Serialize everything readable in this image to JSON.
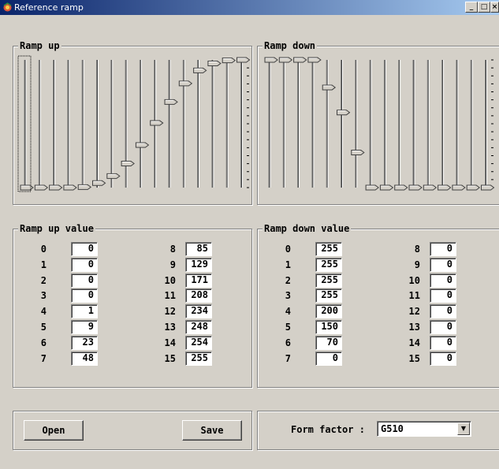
{
  "window": {
    "title": "Reference ramp",
    "minimize_label": "_",
    "maximize_label": "□",
    "close_label": "×"
  },
  "ramp_up": {
    "title": "Ramp up",
    "values": [
      0,
      0,
      0,
      0,
      1,
      9,
      23,
      48,
      85,
      129,
      171,
      208,
      234,
      248,
      254,
      255
    ]
  },
  "ramp_down": {
    "title": "Ramp down",
    "values": [
      255,
      255,
      255,
      255,
      200,
      150,
      70,
      0,
      0,
      0,
      0,
      0,
      0,
      0,
      0,
      0
    ]
  },
  "ramp_up_value": {
    "title": "Ramp up value",
    "left": [
      {
        "index": "0",
        "value": "0"
      },
      {
        "index": "1",
        "value": "0"
      },
      {
        "index": "2",
        "value": "0"
      },
      {
        "index": "3",
        "value": "0"
      },
      {
        "index": "4",
        "value": "1"
      },
      {
        "index": "5",
        "value": "9"
      },
      {
        "index": "6",
        "value": "23"
      },
      {
        "index": "7",
        "value": "48"
      }
    ],
    "right": [
      {
        "index": "8",
        "value": "85"
      },
      {
        "index": "9",
        "value": "129"
      },
      {
        "index": "10",
        "value": "171"
      },
      {
        "index": "11",
        "value": "208"
      },
      {
        "index": "12",
        "value": "234"
      },
      {
        "index": "13",
        "value": "248"
      },
      {
        "index": "14",
        "value": "254"
      },
      {
        "index": "15",
        "value": "255"
      }
    ]
  },
  "ramp_down_value": {
    "title": "Ramp down value",
    "left": [
      {
        "index": "0",
        "value": "255"
      },
      {
        "index": "1",
        "value": "255"
      },
      {
        "index": "2",
        "value": "255"
      },
      {
        "index": "3",
        "value": "255"
      },
      {
        "index": "4",
        "value": "200"
      },
      {
        "index": "5",
        "value": "150"
      },
      {
        "index": "6",
        "value": "70"
      },
      {
        "index": "7",
        "value": "0"
      }
    ],
    "right": [
      {
        "index": "8",
        "value": "0"
      },
      {
        "index": "9",
        "value": "0"
      },
      {
        "index": "10",
        "value": "0"
      },
      {
        "index": "11",
        "value": "0"
      },
      {
        "index": "12",
        "value": "0"
      },
      {
        "index": "13",
        "value": "0"
      },
      {
        "index": "14",
        "value": "0"
      },
      {
        "index": "15",
        "value": "0"
      }
    ]
  },
  "buttons": {
    "open": "Open",
    "save": "Save"
  },
  "form_factor": {
    "label": "Form factor :",
    "selected": "G510"
  },
  "colors": {
    "titlebar_start": "#0a246a",
    "titlebar_end": "#a6caf0",
    "face": "#d4d0c8"
  }
}
